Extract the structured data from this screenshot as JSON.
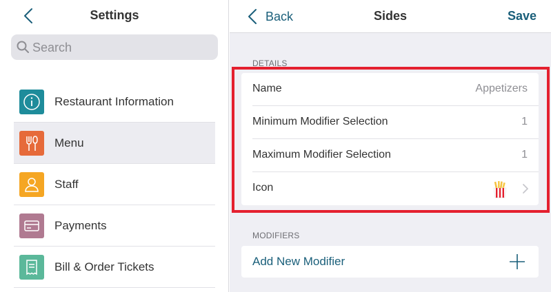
{
  "left": {
    "title": "Settings",
    "search_placeholder": "Search",
    "items": [
      {
        "label": "Restaurant Information",
        "icon": "info-icon",
        "color": "#1e8c9b"
      },
      {
        "label": "Menu",
        "icon": "fork-knife-icon",
        "color": "#e66a3a",
        "selected": true
      },
      {
        "label": "Staff",
        "icon": "person-icon",
        "color": "#f5a623"
      },
      {
        "label": "Payments",
        "icon": "card-icon",
        "color": "#b07a91"
      },
      {
        "label": "Bill & Order Tickets",
        "icon": "receipt-icon",
        "color": "#5bb89a"
      }
    ]
  },
  "right": {
    "back_label": "Back",
    "title": "Sides",
    "save_label": "Save",
    "details_header": "DETAILS",
    "details": [
      {
        "label": "Name",
        "value": "Appetizers"
      },
      {
        "label": "Minimum Modifier Selection",
        "value": "1"
      },
      {
        "label": "Maximum Modifier Selection",
        "value": "1"
      },
      {
        "label": "Icon",
        "icon": "french-fries-icon"
      }
    ],
    "modifiers_header": "MODIFIERS",
    "add_modifier_label": "Add New Modifier"
  },
  "colors": {
    "accent": "#1a5f7a",
    "highlight": "#e4202f",
    "background": "#efeff4"
  }
}
